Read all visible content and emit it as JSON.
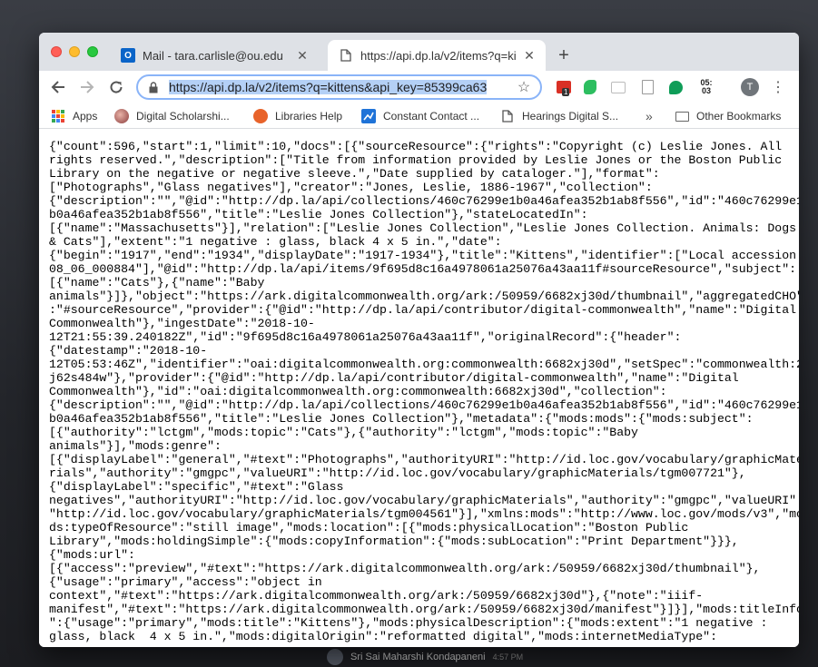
{
  "browser": {
    "tabs": [
      {
        "label": "Mail - tara.carlisle@ou.edu",
        "icon": "outlook-icon",
        "active": false
      },
      {
        "label": "https://api.dp.la/v2/items?q=ki",
        "icon": "document-icon",
        "active": true
      }
    ],
    "url": "https://api.dp.la/v2/items?q=kittens&api_key=85399ca63",
    "extensions": {
      "calendar_badge": "1",
      "clock_text": "05:\n03"
    },
    "avatar_letter": "T"
  },
  "bookmarks": [
    {
      "label": "Apps",
      "icon": "apps-grid-icon"
    },
    {
      "label": "Digital Scholarshi...",
      "icon": "profile-photo-icon"
    },
    {
      "label": "Libraries Help",
      "icon": "libraries-icon"
    },
    {
      "label": "Constant Contact ...",
      "icon": "chart-icon"
    },
    {
      "label": "Hearings Digital S...",
      "icon": "document-icon"
    },
    {
      "label": "»",
      "icon": "chevron-double-icon"
    },
    {
      "label": "Other Bookmarks",
      "icon": "folder-icon"
    }
  ],
  "desktop": {
    "name": "Sri Sai Maharshi Kondapaneni",
    "time": "4:57 PM"
  },
  "content": {
    "lines": [
      "{\"count\":596,\"start\":1,\"limit\":10,\"docs\":[{\"sourceResource\":{\"rights\":\"Copyright (c) Leslie Jones. All",
      "rights reserved.\",\"description\":[\"Title from information provided by Leslie Jones or the Boston Public",
      "Library on the negative or negative sleeve.\",\"Date supplied by cataloger.\"],\"format\":",
      "[\"Photographs\",\"Glass negatives\"],\"creator\":\"Jones, Leslie, 1886-1967\",\"collection\":",
      "{\"description\":\"\",\"@id\":\"http://dp.la/api/collections/460c76299e1b0a46afea352b1ab8f556\",\"id\":\"460c76299e1",
      "b0a46afea352b1ab8f556\",\"title\":\"Leslie Jones Collection\"},\"stateLocatedIn\":",
      "[{\"name\":\"Massachusetts\"}],\"relation\":[\"Leslie Jones Collection\",\"Leslie Jones Collection. Animals: Dogs",
      "& Cats\"],\"extent\":\"1 negative : glass, black 4 x 5 in.\",\"date\":",
      "{\"begin\":\"1917\",\"end\":\"1934\",\"displayDate\":\"1917-1934\"},\"title\":\"Kittens\",\"identifier\":[\"Local accession:",
      "08_06_000884\"],\"@id\":\"http://dp.la/api/items/9f695d8c16a4978061a25076a43aa11f#sourceResource\",\"subject\":",
      "[{\"name\":\"Cats\"},{\"name\":\"Baby",
      "animals\"}]},\"object\":\"https://ark.digitalcommonwealth.org/ark:/50959/6682xj30d/thumbnail\",\"aggregatedCHO\"",
      ":\"#sourceResource\",\"provider\":{\"@id\":\"http://dp.la/api/contributor/digital-commonwealth\",\"name\":\"Digital",
      "Commonwealth\"},\"ingestDate\":\"2018-10-",
      "12T21:55:39.240182Z\",\"id\":\"9f695d8c16a4978061a25076a43aa11f\",\"originalRecord\":{\"header\":",
      "{\"datestamp\":\"2018-10-",
      "12T05:53:46Z\",\"identifier\":\"oai:digitalcommonwealth.org:commonwealth:6682xj30d\",\"setSpec\":\"commonwealth:2",
      "j62s484w\"},\"provider\":{\"@id\":\"http://dp.la/api/contributor/digital-commonwealth\",\"name\":\"Digital",
      "Commonwealth\"},\"id\":\"oai:digitalcommonwealth.org:commonwealth:6682xj30d\",\"collection\":",
      "{\"description\":\"\",\"@id\":\"http://dp.la/api/collections/460c76299e1b0a46afea352b1ab8f556\",\"id\":\"460c76299e1",
      "b0a46afea352b1ab8f556\",\"title\":\"Leslie Jones Collection\"},\"metadata\":{\"mods:mods\":{\"mods:subject\":",
      "[{\"authority\":\"lctgm\",\"mods:topic\":\"Cats\"},{\"authority\":\"lctgm\",\"mods:topic\":\"Baby",
      "animals\"}],\"mods:genre\":",
      "[{\"displayLabel\":\"general\",\"#text\":\"Photographs\",\"authorityURI\":\"http://id.loc.gov/vocabulary/graphicMate",
      "rials\",\"authority\":\"gmgpc\",\"valueURI\":\"http://id.loc.gov/vocabulary/graphicMaterials/tgm007721\"},",
      "{\"displayLabel\":\"specific\",\"#text\":\"Glass",
      "negatives\",\"authorityURI\":\"http://id.loc.gov/vocabulary/graphicMaterials\",\"authority\":\"gmgpc\",\"valueURI\":",
      "\"http://id.loc.gov/vocabulary/graphicMaterials/tgm004561\"}],\"xmlns:mods\":\"http://www.loc.gov/mods/v3\",\"mo",
      "ds:typeOfResource\":\"still image\",\"mods:location\":[{\"mods:physicalLocation\":\"Boston Public",
      "Library\",\"mods:holdingSimple\":{\"mods:copyInformation\":{\"mods:subLocation\":\"Print Department\"}}},",
      "{\"mods:url\":",
      "[{\"access\":\"preview\",\"#text\":\"https://ark.digitalcommonwealth.org/ark:/50959/6682xj30d/thumbnail\"},",
      "{\"usage\":\"primary\",\"access\":\"object in",
      "context\",\"#text\":\"https://ark.digitalcommonwealth.org/ark:/50959/6682xj30d\"},{\"note\":\"iiif-",
      "manifest\",\"#text\":\"https://ark.digitalcommonwealth.org/ark:/50959/6682xj30d/manifest\"}]}],\"mods:titleInfo",
      "\":{\"usage\":\"primary\",\"mods:title\":\"Kittens\"},\"mods:physicalDescription\":{\"mods:extent\":\"1 negative :",
      "glass, black  4 x 5 in.\",\"mods:digitalOrigin\":\"reformatted digital\",\"mods:internetMediaType\":"
    ]
  }
}
